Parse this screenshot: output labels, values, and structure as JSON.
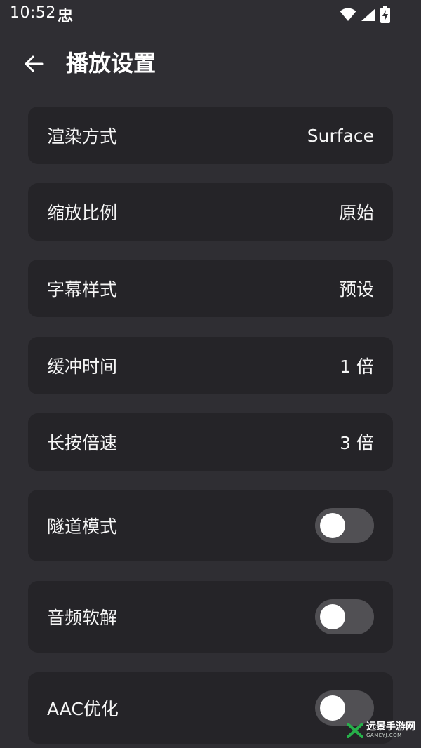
{
  "status_bar": {
    "time": "10:52",
    "app_icon_glyph": "忠",
    "icons": [
      "wifi-icon",
      "signal-icon",
      "battery-charging-icon"
    ]
  },
  "header": {
    "back_icon": "arrow-left-icon",
    "title": "播放设置"
  },
  "settings": [
    {
      "label": "渲染方式",
      "value": "Surface",
      "type": "value"
    },
    {
      "label": "缩放比例",
      "value": "原始",
      "type": "value"
    },
    {
      "label": "字幕样式",
      "value": "预设",
      "type": "value"
    },
    {
      "label": "缓冲时间",
      "value": "1 倍",
      "type": "value"
    },
    {
      "label": "长按倍速",
      "value": "3 倍",
      "type": "value"
    },
    {
      "label": "隧道模式",
      "toggle_on": false,
      "type": "toggle"
    },
    {
      "label": "音频软解",
      "toggle_on": false,
      "type": "toggle"
    },
    {
      "label": "AAC优化",
      "toggle_on": false,
      "type": "toggle"
    }
  ],
  "watermark": {
    "main": "远景手游网",
    "sub": "GAMEYJ.COM"
  },
  "colors": {
    "background": "#2f2e33",
    "card": "#252428",
    "toggle_track_off": "#515054",
    "toggle_knob": "#ffffff",
    "watermark_accent": "#27b04a"
  }
}
